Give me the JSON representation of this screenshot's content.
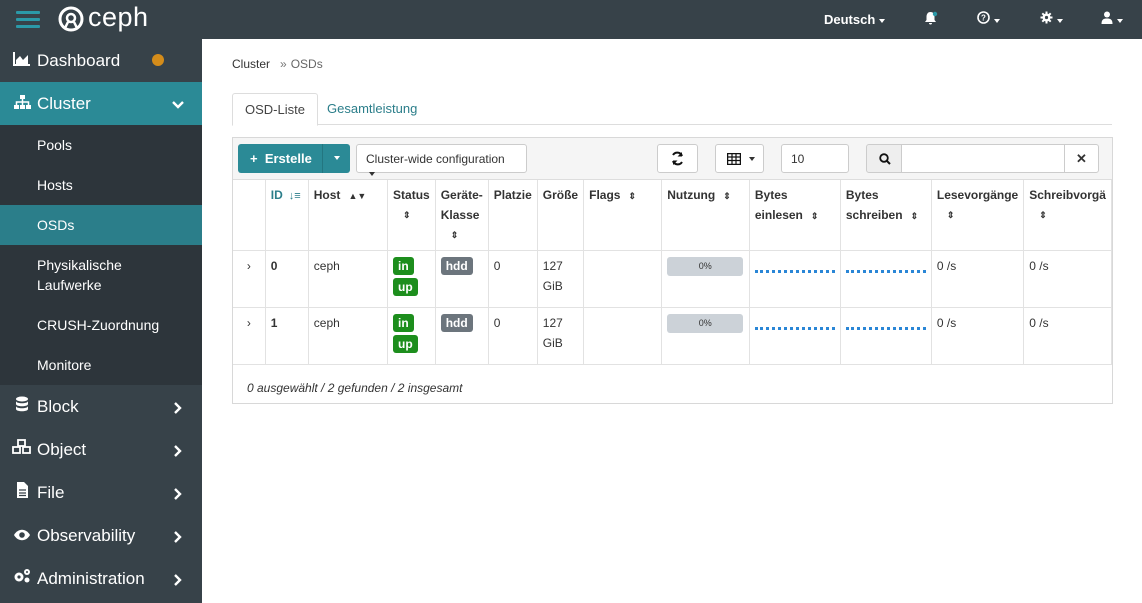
{
  "app": {
    "name": "ceph"
  },
  "topbar": {
    "language": "Deutsch"
  },
  "sidebar": {
    "items": [
      {
        "label": "Dashboard",
        "icon": "area-chart-icon"
      },
      {
        "label": "Cluster",
        "icon": "sitemap-icon"
      },
      {
        "label": "Block",
        "icon": "database-icon"
      },
      {
        "label": "Object",
        "icon": "cubes-icon"
      },
      {
        "label": "File",
        "icon": "file-icon"
      },
      {
        "label": "Observability",
        "icon": "eye-icon"
      },
      {
        "label": "Administration",
        "icon": "cogs-icon"
      }
    ],
    "cluster_sub": [
      {
        "label": "Pools"
      },
      {
        "label": "Hosts"
      },
      {
        "label": "OSDs"
      },
      {
        "label": "Physikalische Laufwerke"
      },
      {
        "label": "CRUSH-Zuordnung"
      },
      {
        "label": "Monitore"
      }
    ],
    "colors": {
      "accent": "#2b8a96",
      "warning_dot": "#d48c1a"
    }
  },
  "breadcrumb": {
    "parent": "Cluster",
    "current": "OSDs"
  },
  "tabs": [
    {
      "label": "OSD-Liste"
    },
    {
      "label": "Gesamtleistung"
    }
  ],
  "toolbar": {
    "create_label": "Erstelle",
    "config_label": "Cluster-wide configuration",
    "page_size": "10",
    "search_placeholder": ""
  },
  "table": {
    "columns": [
      "ID",
      "Host",
      "Status",
      "Geräte-Klasse",
      "Platzie",
      "Größe",
      "Flags",
      "Nutzung",
      "Bytes einlesen",
      "Bytes schreiben",
      "Lesevorgänge",
      "Schreibvorgä"
    ],
    "rows": [
      {
        "id": "0",
        "host": "ceph",
        "status1": "in",
        "status2": "up",
        "class": "hdd",
        "pgs": "0",
        "size1": "127",
        "size2": "GiB",
        "flags": "",
        "usage": "0%",
        "read_ops": "0 /s",
        "write_ops": "0 /s"
      },
      {
        "id": "1",
        "host": "ceph",
        "status1": "in",
        "status2": "up",
        "class": "hdd",
        "pgs": "0",
        "size1": "127",
        "size2": "GiB",
        "flags": "",
        "usage": "0%",
        "read_ops": "0 /s",
        "write_ops": "0 /s"
      }
    ],
    "footer": "0 ausgewählt / 2 gefunden / 2 insgesamt"
  }
}
